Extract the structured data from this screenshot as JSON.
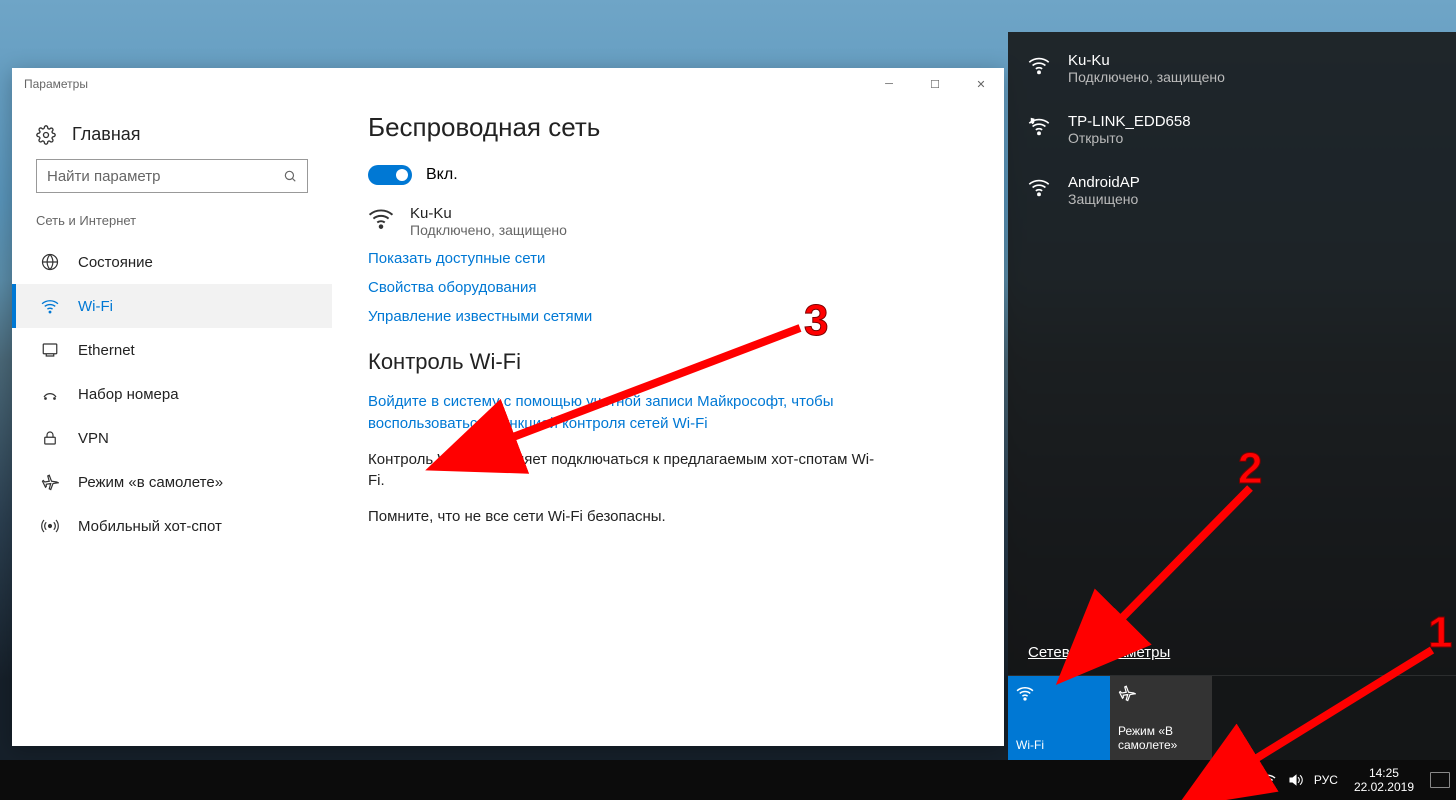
{
  "settings": {
    "title": "Параметры",
    "home": "Главная",
    "search_placeholder": "Найти параметр",
    "section": "Сеть и Интернет",
    "nav": [
      {
        "id": "status",
        "label": "Состояние",
        "active": false
      },
      {
        "id": "wifi",
        "label": "Wi-Fi",
        "active": true
      },
      {
        "id": "ethernet",
        "label": "Ethernet",
        "active": false
      },
      {
        "id": "dialup",
        "label": "Набор номера",
        "active": false
      },
      {
        "id": "vpn",
        "label": "VPN",
        "active": false
      },
      {
        "id": "airplane",
        "label": "Режим «в самолете»",
        "active": false
      },
      {
        "id": "hotspot",
        "label": "Мобильный хот-спот",
        "active": false
      }
    ],
    "content": {
      "heading1": "Беспроводная сеть",
      "toggle_label": "Вкл.",
      "connected_name": "Ku-Ku",
      "connected_status": "Подключено, защищено",
      "link_show_nets": "Показать доступные сети",
      "link_hw_props": "Свойства оборудования",
      "link_known": "Управление известными сетями",
      "heading2": "Контроль Wi-Fi",
      "link_signin": "Войдите в систему с помощью учетной записи Майкрософт, чтобы воспользоваться функцией контроля сетей Wi-Fi",
      "para1": "Контроль Wi-Fi позволяет подключаться к предлагаемым хот-спотам Wi-Fi.",
      "para2": "Помните, что не все сети Wi-Fi безопасны."
    }
  },
  "flyout": {
    "networks": [
      {
        "name": "Ku-Ku",
        "status": "Подключено, защищено",
        "secured": true,
        "connected": true
      },
      {
        "name": "TP-LINK_EDD658",
        "status": "Открыто",
        "secured": false,
        "connected": false,
        "shielded": true
      },
      {
        "name": "AndroidAP",
        "status": "Защищено",
        "secured": true,
        "connected": false
      }
    ],
    "settings_link": "Сетевые параметры",
    "tiles": {
      "wifi": "Wi-Fi",
      "airplane": "Режим «В самолете»"
    }
  },
  "taskbar": {
    "lang": "РУС",
    "time": "14:25",
    "date": "22.02.2019"
  },
  "annotations": {
    "n1": "1",
    "n2": "2",
    "n3": "3"
  }
}
